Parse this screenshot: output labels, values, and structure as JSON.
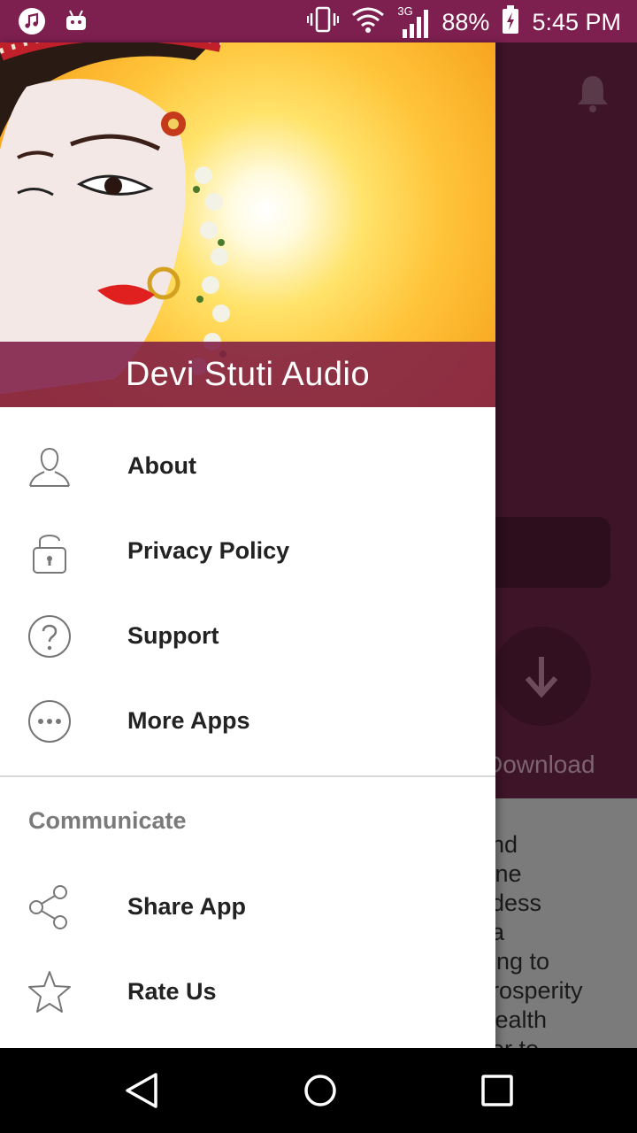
{
  "status_bar": {
    "battery": "88%",
    "time": "5:45 PM",
    "network": "3G",
    "icons": [
      "music-icon",
      "android-icon",
      "vibrate-icon",
      "wifi-icon",
      "signal-icon",
      "battery-charging-icon"
    ]
  },
  "background": {
    "download_label": "Download",
    "body_text": "and\nvine\nddess\nba\nning to\nprosperity\nwealth\nper to"
  },
  "drawer": {
    "title": "Devi Stuti Audio",
    "items": [
      {
        "label": "About",
        "icon": "person-icon"
      },
      {
        "label": "Privacy Policy",
        "icon": "lock-icon"
      },
      {
        "label": "Support",
        "icon": "help-icon"
      },
      {
        "label": "More Apps",
        "icon": "more-icon"
      }
    ],
    "section": "Communicate",
    "communicate_items": [
      {
        "label": "Share App",
        "icon": "share-icon"
      },
      {
        "label": "Rate Us",
        "icon": "star-icon"
      }
    ]
  },
  "nav_bar": {
    "icons": [
      "back-icon",
      "home-icon",
      "recents-icon"
    ]
  },
  "colors": {
    "status_bar": "#7d1f4f",
    "header_dim": "#3e1428",
    "hero_band": "#801c46",
    "menu_text": "#222222",
    "section_text": "#7a7a7a"
  }
}
